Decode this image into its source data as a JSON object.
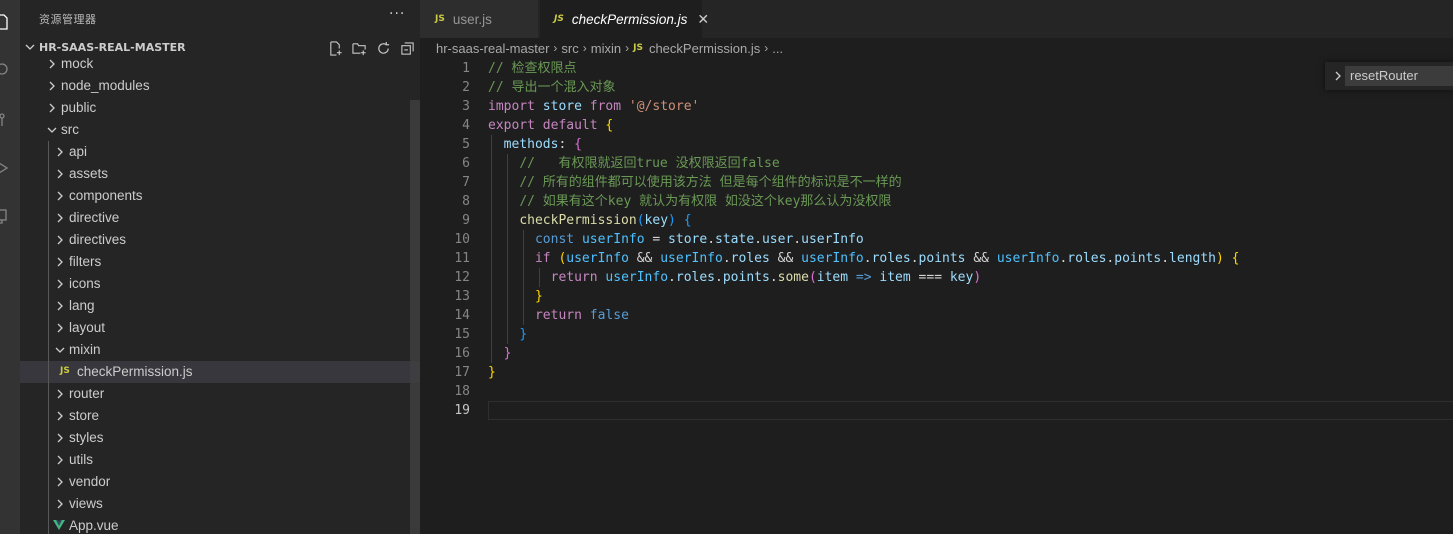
{
  "sidebar": {
    "title": "资源管理器",
    "more": "···",
    "project": "HR-SAAS-REAL-MASTER",
    "tree": [
      {
        "label": "mock",
        "type": "folder",
        "level": 1,
        "expanded": false
      },
      {
        "label": "node_modules",
        "type": "folder",
        "level": 1,
        "expanded": false
      },
      {
        "label": "public",
        "type": "folder",
        "level": 1,
        "expanded": false
      },
      {
        "label": "src",
        "type": "folder",
        "level": 1,
        "expanded": true
      },
      {
        "label": "api",
        "type": "folder",
        "level": 2,
        "expanded": false
      },
      {
        "label": "assets",
        "type": "folder",
        "level": 2,
        "expanded": false
      },
      {
        "label": "components",
        "type": "folder",
        "level": 2,
        "expanded": false
      },
      {
        "label": "directive",
        "type": "folder",
        "level": 2,
        "expanded": false
      },
      {
        "label": "directives",
        "type": "folder",
        "level": 2,
        "expanded": false
      },
      {
        "label": "filters",
        "type": "folder",
        "level": 2,
        "expanded": false
      },
      {
        "label": "icons",
        "type": "folder",
        "level": 2,
        "expanded": false
      },
      {
        "label": "lang",
        "type": "folder",
        "level": 2,
        "expanded": false
      },
      {
        "label": "layout",
        "type": "folder",
        "level": 2,
        "expanded": false
      },
      {
        "label": "mixin",
        "type": "folder",
        "level": 2,
        "expanded": true
      },
      {
        "label": "checkPermission.js",
        "type": "js",
        "level": 3,
        "selected": true
      },
      {
        "label": "router",
        "type": "folder",
        "level": 2,
        "expanded": false
      },
      {
        "label": "store",
        "type": "folder",
        "level": 2,
        "expanded": false
      },
      {
        "label": "styles",
        "type": "folder",
        "level": 2,
        "expanded": false
      },
      {
        "label": "utils",
        "type": "folder",
        "level": 2,
        "expanded": false
      },
      {
        "label": "vendor",
        "type": "folder",
        "level": 2,
        "expanded": false
      },
      {
        "label": "views",
        "type": "folder",
        "level": 2,
        "expanded": false
      },
      {
        "label": "App.vue",
        "type": "vue",
        "level": 2
      }
    ]
  },
  "tabs": [
    {
      "label": "user.js",
      "icon": "JS",
      "active": false
    },
    {
      "label": "checkPermission.js",
      "icon": "JS",
      "active": true,
      "close": "✕"
    }
  ],
  "breadcrumb": {
    "parts": [
      "hr-saas-real-master",
      "src",
      "mixin"
    ],
    "file": "checkPermission.js",
    "icon": "JS",
    "tail": "..."
  },
  "sticky_scroll": {
    "label": "resetRouter"
  },
  "editor": {
    "line_numbers": [
      "1",
      "2",
      "3",
      "4",
      "5",
      "6",
      "7",
      "8",
      "9",
      "10",
      "11",
      "12",
      "13",
      "14",
      "15",
      "16",
      "17",
      "18",
      "19"
    ],
    "current_line": 19,
    "lines": [
      [
        {
          "t": "// 检查权限点",
          "c": "com"
        }
      ],
      [
        {
          "t": "// 导出一个混入对象",
          "c": "com"
        }
      ],
      [
        {
          "t": "import",
          "c": "kw"
        },
        {
          "t": " ",
          "c": "op"
        },
        {
          "t": "store",
          "c": "var"
        },
        {
          "t": " ",
          "c": "op"
        },
        {
          "t": "from",
          "c": "kw"
        },
        {
          "t": " ",
          "c": "op"
        },
        {
          "t": "'@/store'",
          "c": "str"
        }
      ],
      [
        {
          "t": "export",
          "c": "kw"
        },
        {
          "t": " ",
          "c": "op"
        },
        {
          "t": "default",
          "c": "kw"
        },
        {
          "t": " ",
          "c": "op"
        },
        {
          "t": "{",
          "c": "p1"
        }
      ],
      [
        {
          "t": "  ",
          "c": "op"
        },
        {
          "t": "methods",
          "c": "var"
        },
        {
          "t": ": ",
          "c": "op"
        },
        {
          "t": "{",
          "c": "p2"
        }
      ],
      [
        {
          "t": "    ",
          "c": "op"
        },
        {
          "t": "//   有权限就返回true 没权限返回false",
          "c": "com"
        }
      ],
      [
        {
          "t": "    ",
          "c": "op"
        },
        {
          "t": "// 所有的组件都可以使用该方法 但是每个组件的标识是不一样的",
          "c": "com"
        }
      ],
      [
        {
          "t": "    ",
          "c": "op"
        },
        {
          "t": "// 如果有这个key 就认为有权限 如没这个key那么认为没权限",
          "c": "com"
        }
      ],
      [
        {
          "t": "    ",
          "c": "op"
        },
        {
          "t": "checkPermission",
          "c": "fn"
        },
        {
          "t": "(",
          "c": "p3"
        },
        {
          "t": "key",
          "c": "var"
        },
        {
          "t": ")",
          "c": "p3"
        },
        {
          "t": " ",
          "c": "op"
        },
        {
          "t": "{",
          "c": "p3"
        }
      ],
      [
        {
          "t": "      ",
          "c": "op"
        },
        {
          "t": "const",
          "c": "blue"
        },
        {
          "t": " ",
          "c": "op"
        },
        {
          "t": "userInfo",
          "c": "const"
        },
        {
          "t": " = ",
          "c": "op"
        },
        {
          "t": "store",
          "c": "var"
        },
        {
          "t": ".",
          "c": "op"
        },
        {
          "t": "state",
          "c": "var"
        },
        {
          "t": ".",
          "c": "op"
        },
        {
          "t": "user",
          "c": "var"
        },
        {
          "t": ".",
          "c": "op"
        },
        {
          "t": "userInfo",
          "c": "var"
        }
      ],
      [
        {
          "t": "      ",
          "c": "op"
        },
        {
          "t": "if",
          "c": "kw"
        },
        {
          "t": " ",
          "c": "op"
        },
        {
          "t": "(",
          "c": "p1"
        },
        {
          "t": "userInfo",
          "c": "const"
        },
        {
          "t": " && ",
          "c": "op"
        },
        {
          "t": "userInfo",
          "c": "const"
        },
        {
          "t": ".",
          "c": "op"
        },
        {
          "t": "roles",
          "c": "var"
        },
        {
          "t": " && ",
          "c": "op"
        },
        {
          "t": "userInfo",
          "c": "const"
        },
        {
          "t": ".",
          "c": "op"
        },
        {
          "t": "roles",
          "c": "var"
        },
        {
          "t": ".",
          "c": "op"
        },
        {
          "t": "points",
          "c": "var"
        },
        {
          "t": " && ",
          "c": "op"
        },
        {
          "t": "userInfo",
          "c": "const"
        },
        {
          "t": ".",
          "c": "op"
        },
        {
          "t": "roles",
          "c": "var"
        },
        {
          "t": ".",
          "c": "op"
        },
        {
          "t": "points",
          "c": "var"
        },
        {
          "t": ".",
          "c": "op"
        },
        {
          "t": "length",
          "c": "var"
        },
        {
          "t": ")",
          "c": "p1"
        },
        {
          "t": " ",
          "c": "op"
        },
        {
          "t": "{",
          "c": "p1"
        }
      ],
      [
        {
          "t": "        ",
          "c": "op"
        },
        {
          "t": "return",
          "c": "kw"
        },
        {
          "t": " ",
          "c": "op"
        },
        {
          "t": "userInfo",
          "c": "const"
        },
        {
          "t": ".",
          "c": "op"
        },
        {
          "t": "roles",
          "c": "var"
        },
        {
          "t": ".",
          "c": "op"
        },
        {
          "t": "points",
          "c": "var"
        },
        {
          "t": ".",
          "c": "op"
        },
        {
          "t": "some",
          "c": "fn"
        },
        {
          "t": "(",
          "c": "p2"
        },
        {
          "t": "item",
          "c": "var"
        },
        {
          "t": " ",
          "c": "op"
        },
        {
          "t": "=>",
          "c": "blue"
        },
        {
          "t": " ",
          "c": "op"
        },
        {
          "t": "item",
          "c": "var"
        },
        {
          "t": " === ",
          "c": "op"
        },
        {
          "t": "key",
          "c": "var"
        },
        {
          "t": ")",
          "c": "p2"
        }
      ],
      [
        {
          "t": "      ",
          "c": "op"
        },
        {
          "t": "}",
          "c": "p1"
        }
      ],
      [
        {
          "t": "      ",
          "c": "op"
        },
        {
          "t": "return",
          "c": "kw"
        },
        {
          "t": " ",
          "c": "op"
        },
        {
          "t": "false",
          "c": "blue"
        }
      ],
      [
        {
          "t": "    ",
          "c": "op"
        },
        {
          "t": "}",
          "c": "p3"
        }
      ],
      [
        {
          "t": "  ",
          "c": "op"
        },
        {
          "t": "}",
          "c": "p2"
        }
      ],
      [
        {
          "t": "}",
          "c": "p1"
        }
      ],
      [],
      []
    ]
  }
}
